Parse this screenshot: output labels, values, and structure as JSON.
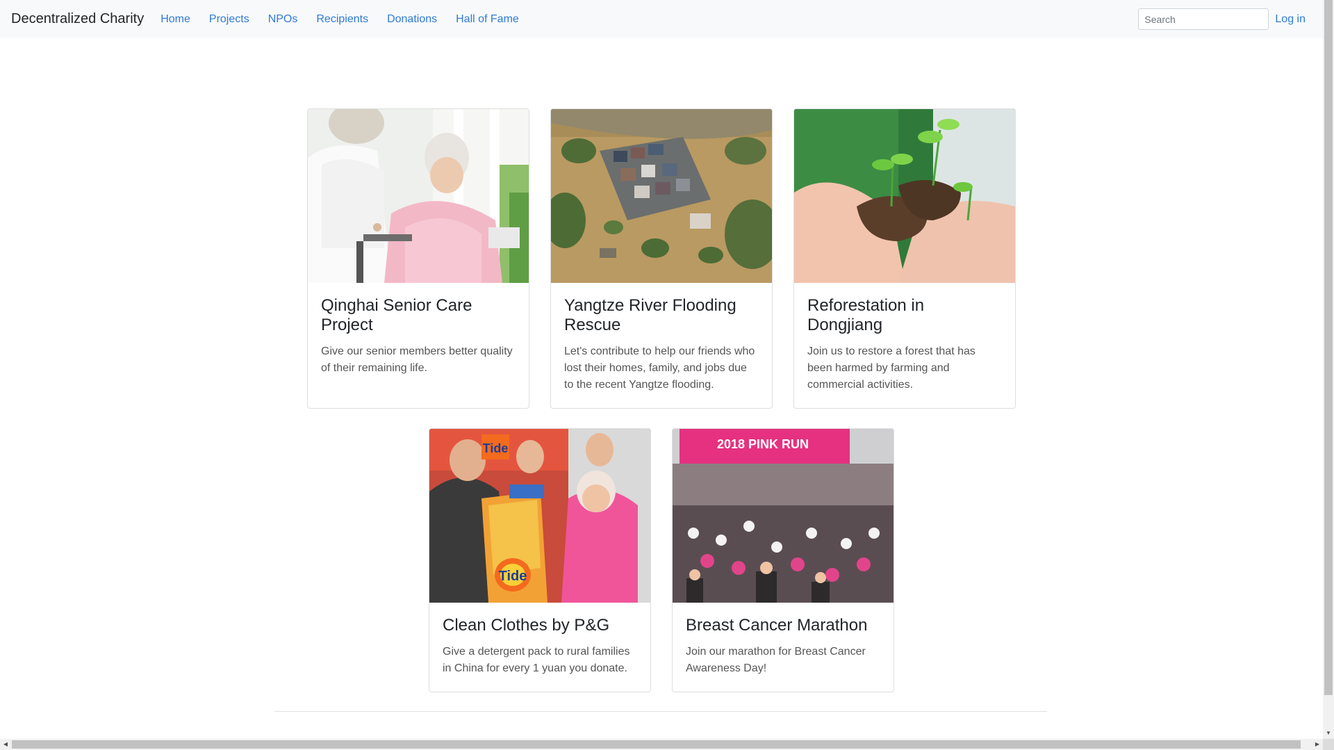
{
  "navbar": {
    "brand": "Decentralized Charity",
    "links": [
      "Home",
      "Projects",
      "NPOs",
      "Recipients",
      "Donations",
      "Hall of Fame"
    ],
    "search_placeholder": "Search",
    "login_label": "Log in",
    "link_color": "#2f7bd5",
    "background": "#f8f9fa"
  },
  "projects": [
    {
      "title": "Qinghai Senior Care Project",
      "description": "Give our senior members better quality of their remaining life.",
      "image": "senior-care-photo"
    },
    {
      "title": "Yangtze River Flooding Rescue",
      "description": "Let's contribute to help our friends who lost their homes, family, and jobs due to the recent Yangtze flooding.",
      "image": "flooded-village-photo"
    },
    {
      "title": "Reforestation in Dongjiang",
      "description": "Join us to restore a forest that has been harmed by farming and commercial activities.",
      "image": "seedling-hands-photo"
    },
    {
      "title": "Clean Clothes by P&G",
      "description": "Give a detergent pack to rural families in China for every 1 yuan you donate.",
      "image": "detergent-donation-photo",
      "image_text": [
        "Tide",
        "Tide"
      ]
    },
    {
      "title": "Breast Cancer Marathon",
      "description": "Join our marathon for Breast Cancer Awareness Day!",
      "image": "pink-run-photo",
      "image_text": [
        "2018 PINK RUN"
      ]
    }
  ]
}
